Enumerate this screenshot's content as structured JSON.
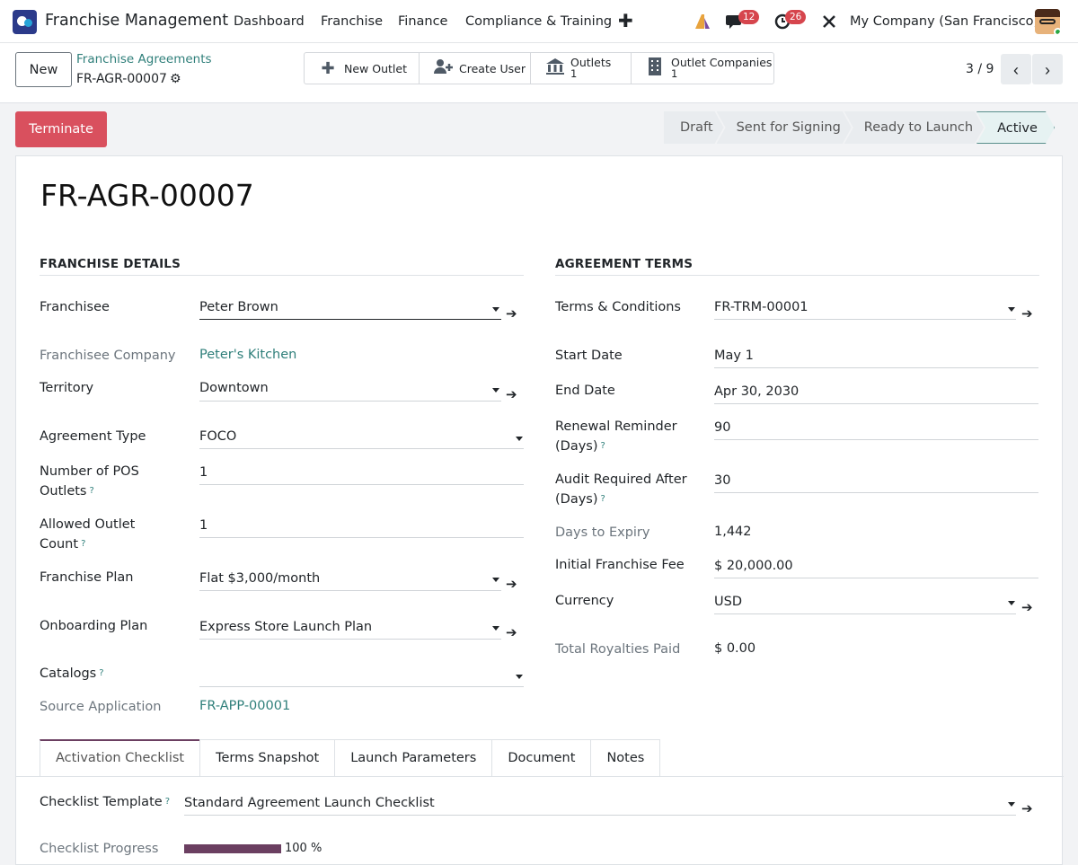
{
  "navbar": {
    "app_name": "Franchise Management",
    "menu": [
      "Dashboard",
      "Franchise",
      "Finance",
      "Compliance & Training"
    ],
    "messages_count": "12",
    "activities_count": "26",
    "company": "My Company (San Francisco)"
  },
  "control": {
    "new_label": "New",
    "breadcrumb": "Franchise Agreements",
    "record": "FR-AGR-00007",
    "smart_buttons": {
      "new_outlet": "New Outlet",
      "create_user": "Create User",
      "outlets_label": "Outlets",
      "outlets_value": "1",
      "outlet_companies_label": "Outlet Companies",
      "outlet_companies_value": "1"
    },
    "pager": "3 / 9"
  },
  "actions": {
    "terminate": "Terminate"
  },
  "status": {
    "stages": [
      "Draft",
      "Sent for Signing",
      "Ready to Launch",
      "Active"
    ],
    "current": "Active"
  },
  "form": {
    "title": "FR-AGR-00007",
    "franchise_details": {
      "heading": "FRANCHISE DETAILS",
      "franchisee_label": "Franchisee",
      "franchisee_value": "Peter Brown",
      "company_label": "Franchisee Company",
      "company_value": "Peter's Kitchen",
      "territory_label": "Territory",
      "territory_value": "Downtown",
      "agreement_type_label": "Agreement Type",
      "agreement_type_value": "FOCO",
      "pos_label_1": "Number of POS",
      "pos_label_2": "Outlets",
      "pos_value": "1",
      "allowed_label_1": "Allowed Outlet",
      "allowed_label_2": "Count",
      "allowed_value": "1",
      "plan_label": "Franchise Plan",
      "plan_value": "Flat $3,000/month",
      "onboarding_label": "Onboarding Plan",
      "onboarding_value": "Express Store Launch Plan",
      "catalogs_label": "Catalogs",
      "catalogs_value": "",
      "source_label": "Source Application",
      "source_value": "FR-APP-00001"
    },
    "agreement_terms": {
      "heading": "AGREEMENT TERMS",
      "terms_label": "Terms & Conditions",
      "terms_value": "FR-TRM-00001",
      "start_label": "Start Date",
      "start_value": "May 1",
      "end_label": "End Date",
      "end_value": "Apr 30, 2030",
      "renewal_label_1": "Renewal Reminder",
      "renewal_label_2": "(Days)",
      "renewal_value": "90",
      "audit_label_1": "Audit Required After",
      "audit_label_2": "(Days)",
      "audit_value": "30",
      "expiry_label": "Days to Expiry",
      "expiry_value": "1,442",
      "fee_label": "Initial Franchise Fee",
      "fee_value": "$ 20,000.00",
      "currency_label": "Currency",
      "currency_value": "USD",
      "royalties_label": "Total Royalties Paid",
      "royalties_value": "$ 0.00"
    },
    "tabs": [
      "Activation Checklist",
      "Terms Snapshot",
      "Launch Parameters",
      "Document",
      "Notes"
    ],
    "checklist_template_label": "Checklist Template",
    "checklist_template_value": "Standard Agreement Launch Checklist",
    "checklist_progress_label": "Checklist Progress",
    "checklist_progress_value": 100,
    "checklist_progress_text": "100 %"
  },
  "colors": {
    "accent": "#2f7f7a",
    "primary": "#6b3f61",
    "danger": "#d9505e"
  }
}
